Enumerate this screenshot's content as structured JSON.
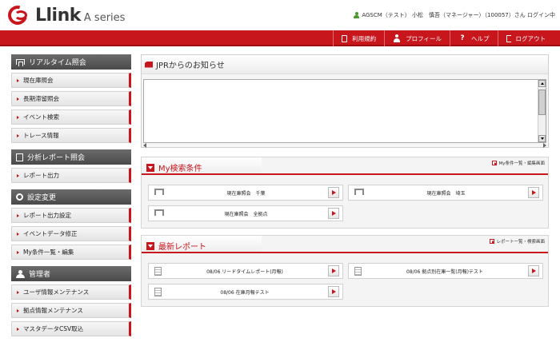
{
  "header": {
    "logo_text": "Llink",
    "logo_sub": "A series",
    "user_text": "AGSCM（テスト） 小松　慎吾（マネージャー）（100057）さん ログイン中"
  },
  "topnav": {
    "items": [
      {
        "label": "利用規約",
        "icon": "document-icon"
      },
      {
        "label": "プロフィール",
        "icon": "person-icon"
      },
      {
        "label": "ヘルプ",
        "icon": "question-icon"
      },
      {
        "label": "ログアウト",
        "icon": "logout-icon"
      }
    ],
    "help_glyph": "?"
  },
  "sidebar": {
    "sections": [
      {
        "title": "リアルタイム照会",
        "items": [
          "現在庫照会",
          "長期滞留照会",
          "イベント検索",
          "トレース情報"
        ]
      },
      {
        "title": "分析レポート照会",
        "items": [
          "レポート出力"
        ]
      },
      {
        "title": "設定変更",
        "items": [
          "レポート出力設定",
          "イベントデータ修正",
          "My条件一覧・編集"
        ]
      },
      {
        "title": "管理者",
        "items": [
          "ユーザ情報メンテナンス",
          "拠点情報メンテナンス",
          "マスタデータCSV取込"
        ]
      }
    ]
  },
  "notice": {
    "title": "JPRからのお知らせ"
  },
  "my_search": {
    "title": "My検索条件",
    "link": "My条件一覧・編集画面",
    "items": [
      "現在庫照会　千葉",
      "現在庫照会　埼玉",
      "現在庫照会　全拠点"
    ]
  },
  "latest_reports": {
    "title": "最新レポート",
    "link": "レポート一覧・検索画面",
    "items": [
      "08/06 リードタイムレポート(月報)",
      "08/06 拠点別在庫一覧(月報)テスト",
      "08/06 在庫月報テスト"
    ]
  },
  "colors": {
    "brand_red": "#c8161d",
    "sidebar_head": "#555555"
  }
}
